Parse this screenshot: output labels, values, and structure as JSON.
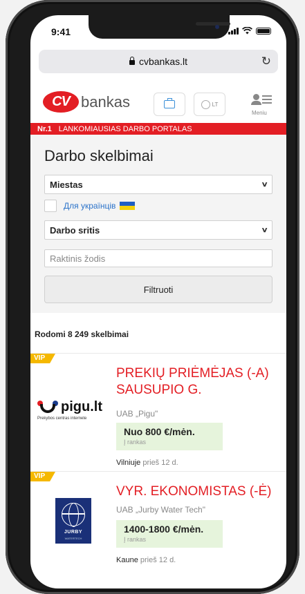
{
  "status_bar": {
    "time": "9:41"
  },
  "browser": {
    "url": "cvbankas.lt"
  },
  "header": {
    "logo_cv": "CV",
    "logo_text": "bankas",
    "lang_label": "LT",
    "menu_label": "Meniu"
  },
  "banner": {
    "rank": "Nr.1",
    "tagline": "LANKOMIAUSIAS DARBO PORTALAS"
  },
  "search": {
    "title": "Darbo skelbimai",
    "city_select": "Miestas",
    "ukraine_label": "Для українців",
    "field_select": "Darbo sritis",
    "keyword_placeholder": "Raktinis žodis",
    "filter_button": "Filtruoti"
  },
  "results": {
    "count_text": "Rodomi 8 249 skelbimai"
  },
  "jobs": [
    {
      "badge": "VIP",
      "title": "PREKIŲ PRIĖMĖJAS (-A) SAUSUPIO G.",
      "company": "UAB „Pigu\"",
      "salary": "Nuo 800 €/mėn.",
      "salary_note": "Į rankas",
      "location": "Vilniuje",
      "posted": "prieš 12 d.",
      "logo_name": "pigu.lt",
      "logo_sub": "Prekybos centras internete"
    },
    {
      "badge": "VIP",
      "title": "VYR. EKONOMISTAS (-Ė)",
      "company": "UAB „Jurby Water Tech\"",
      "salary": "1400-1800 €/mėn.",
      "salary_note": "Į rankas",
      "location": "Kaune",
      "posted": "prieš 12 d.",
      "logo_name": "JURBY",
      "logo_sub": "WATERTECH"
    }
  ],
  "colors": {
    "brand_red": "#e31e24",
    "vip_yellow": "#f5b800",
    "salary_bg": "#e6f4dc",
    "link_blue": "#2a72c9"
  }
}
